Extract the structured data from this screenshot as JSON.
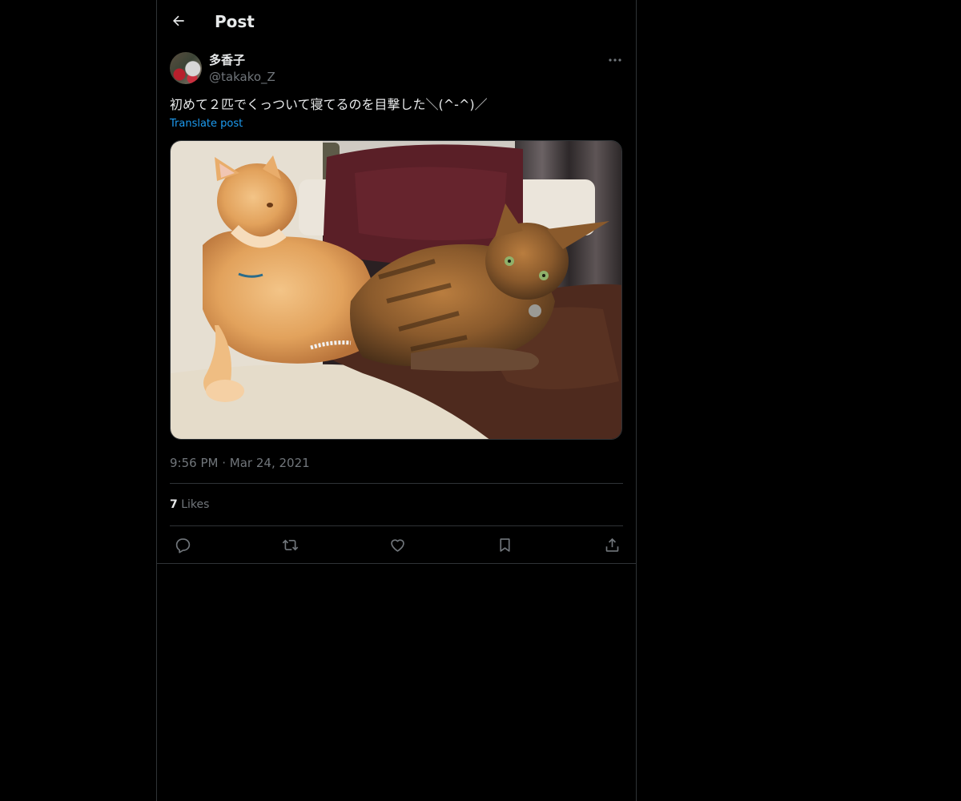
{
  "header": {
    "title": "Post"
  },
  "post": {
    "author": {
      "display_name": "多香子",
      "handle": "@takako_Z"
    },
    "text": "初めて２匹でくっついて寝てるのを目撃した＼(^-^)／",
    "translate_label": "Translate post",
    "time": "9:56 PM",
    "separator": "·",
    "date": "Mar 24, 2021",
    "likes_count": "7",
    "likes_label": "Likes"
  },
  "icons": {
    "back": "arrow-left-icon",
    "more": "more-dots-icon",
    "reply": "reply-icon",
    "repost": "repost-icon",
    "like": "heart-icon",
    "bookmark": "bookmark-icon",
    "share": "share-icon"
  },
  "colors": {
    "background": "#000000",
    "text": "#e7e9ea",
    "secondary": "#71767b",
    "accent": "#1d9bf0",
    "border": "#2f3336"
  }
}
